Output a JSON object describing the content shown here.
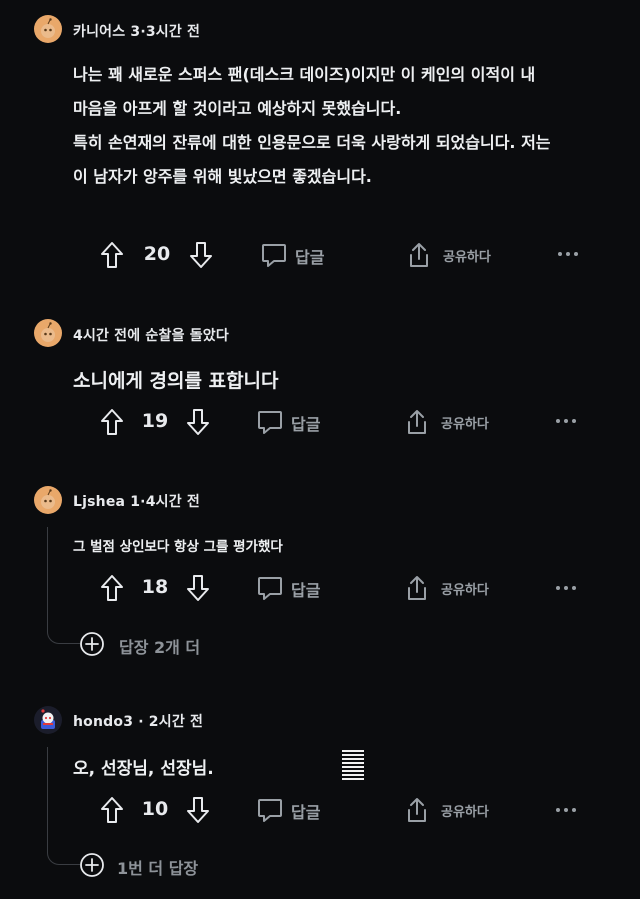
{
  "comments": [
    {
      "meta": "카니어스 3·3시간 전",
      "body_lines": [
        "나는 꽤 새로운 스퍼스 팬(데스크 데이즈)이지만 이 케인의 이적이 내",
        "마음을 아프게 할 것이라고 예상하지 못했습니다.",
        "특히 손연재의 잔류에 대한 인용문으로 더욱 사랑하게 되었습니다. 저는",
        "이 남자가 앙주를 위해 빛났으면 좋겠습니다."
      ],
      "votes": "20",
      "reply_label": "답글",
      "share_label": "공유하다"
    },
    {
      "meta": "4시간 전에 순찰을 돌았다",
      "body": "소니에게 경의를 표합니다",
      "votes": "19",
      "reply_label": "답글",
      "share_label": "공유하다"
    },
    {
      "meta": "Ljshea 1·4시간 전",
      "body": "그 벌점 상인보다 항상 그를 평가했다",
      "votes": "18",
      "reply_label": "답글",
      "share_label": "공유하다",
      "more_replies": "답장 2개 더"
    },
    {
      "meta": "hondo3 · 2시간 전",
      "body": "오, 선장님, 선장님.",
      "votes": "10",
      "reply_label": "답글",
      "share_label": "공유하다",
      "more_replies": "1번 더 답장"
    }
  ],
  "icons": {
    "upvote": "arrow-up-icon",
    "downvote": "arrow-down-icon",
    "reply": "speech-bubble-icon",
    "share": "share-icon",
    "more": "ellipsis-icon",
    "expand": "plus-circle-icon"
  }
}
